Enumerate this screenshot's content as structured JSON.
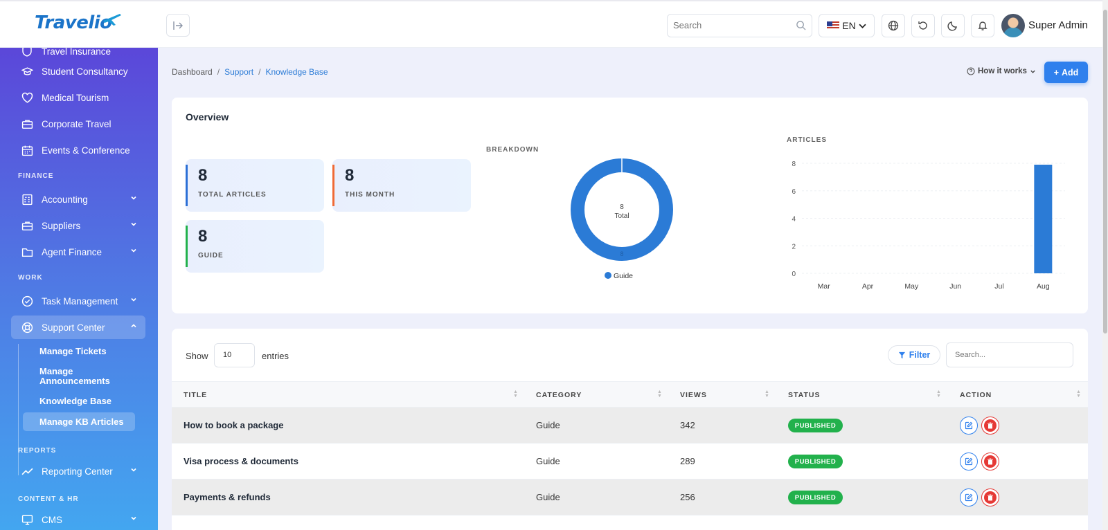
{
  "brand": {
    "name": "Travelio"
  },
  "topbar": {
    "search_placeholder": "Search",
    "language": "EN",
    "user_name": "Super Admin"
  },
  "sidebar": {
    "items_top": [
      {
        "label": "Travel Insurance",
        "icon": "shield-icon"
      },
      {
        "label": "Student Consultancy",
        "icon": "graduation-cap-icon"
      },
      {
        "label": "Medical Tourism",
        "icon": "heart-icon"
      },
      {
        "label": "Corporate Travel",
        "icon": "briefcase-icon"
      },
      {
        "label": "Events & Conference",
        "icon": "calendar-icon"
      }
    ],
    "sections": {
      "finance": "FINANCE",
      "work": "WORK",
      "reports": "REPORTS",
      "content": "CONTENT & HR"
    },
    "finance_items": [
      {
        "label": "Accounting",
        "icon": "calculator-icon"
      },
      {
        "label": "Suppliers",
        "icon": "briefcase-icon"
      },
      {
        "label": "Agent Finance",
        "icon": "folder-icon"
      }
    ],
    "work_items": [
      {
        "label": "Task Management",
        "icon": "check-circle-icon"
      },
      {
        "label": "Support Center",
        "icon": "lifebuoy-icon"
      }
    ],
    "support_sub": [
      {
        "label": "Manage Tickets"
      },
      {
        "label": "Manage Announcements"
      },
      {
        "label": "Knowledge Base"
      },
      {
        "label": "Manage KB Articles"
      }
    ],
    "reports_items": [
      {
        "label": "Reporting Center",
        "icon": "trend-line-icon"
      }
    ],
    "content_items": [
      {
        "label": "CMS",
        "icon": "monitor-icon"
      }
    ]
  },
  "breadcrumb": {
    "home": "Dashboard",
    "section": "Support",
    "current": "Knowledge Base",
    "sep": "/"
  },
  "header_actions": {
    "how_it_works": "How it works",
    "add": "Add"
  },
  "overview": {
    "title": "Overview",
    "stats": [
      {
        "value": "8",
        "label": "TOTAL ARTICLES",
        "accent": "#2b6fd6"
      },
      {
        "value": "8",
        "label": "THIS MONTH",
        "accent": "#f06a35"
      },
      {
        "value": "8",
        "label": "GUIDE",
        "accent": "#22b14c"
      }
    ],
    "breakdown_title": "BREAKDOWN",
    "articles_title": "ARTICLES"
  },
  "chart_data": [
    {
      "type": "pie",
      "title": "BREAKDOWN",
      "categories": [
        "Guide"
      ],
      "values": [
        8
      ],
      "center_value": "8",
      "center_label": "Total",
      "legend": "bottom",
      "colors": [
        "#2b7bd6"
      ]
    },
    {
      "type": "bar",
      "title": "ARTICLES",
      "categories": [
        "Mar",
        "Apr",
        "May",
        "Jun",
        "Jul",
        "Aug"
      ],
      "values": [
        0,
        0,
        0,
        0,
        0,
        8
      ],
      "ylim": [
        0,
        8
      ],
      "yticks": [
        0,
        2,
        4,
        6,
        8
      ],
      "grid": true,
      "colors": [
        "#2b7bd6"
      ]
    }
  ],
  "table": {
    "show_label": "Show",
    "page_size": "10",
    "entries_label": "entries",
    "filter_label": "Filter",
    "search_placeholder": "Search...",
    "columns": [
      "TITLE",
      "CATEGORY",
      "VIEWS",
      "STATUS",
      "ACTION"
    ],
    "rows": [
      {
        "title": "How to book a package",
        "category": "Guide",
        "views": "342",
        "status": "PUBLISHED"
      },
      {
        "title": "Visa process & documents",
        "category": "Guide",
        "views": "289",
        "status": "PUBLISHED"
      },
      {
        "title": "Payments & refunds",
        "category": "Guide",
        "views": "256",
        "status": "PUBLISHED"
      }
    ]
  }
}
